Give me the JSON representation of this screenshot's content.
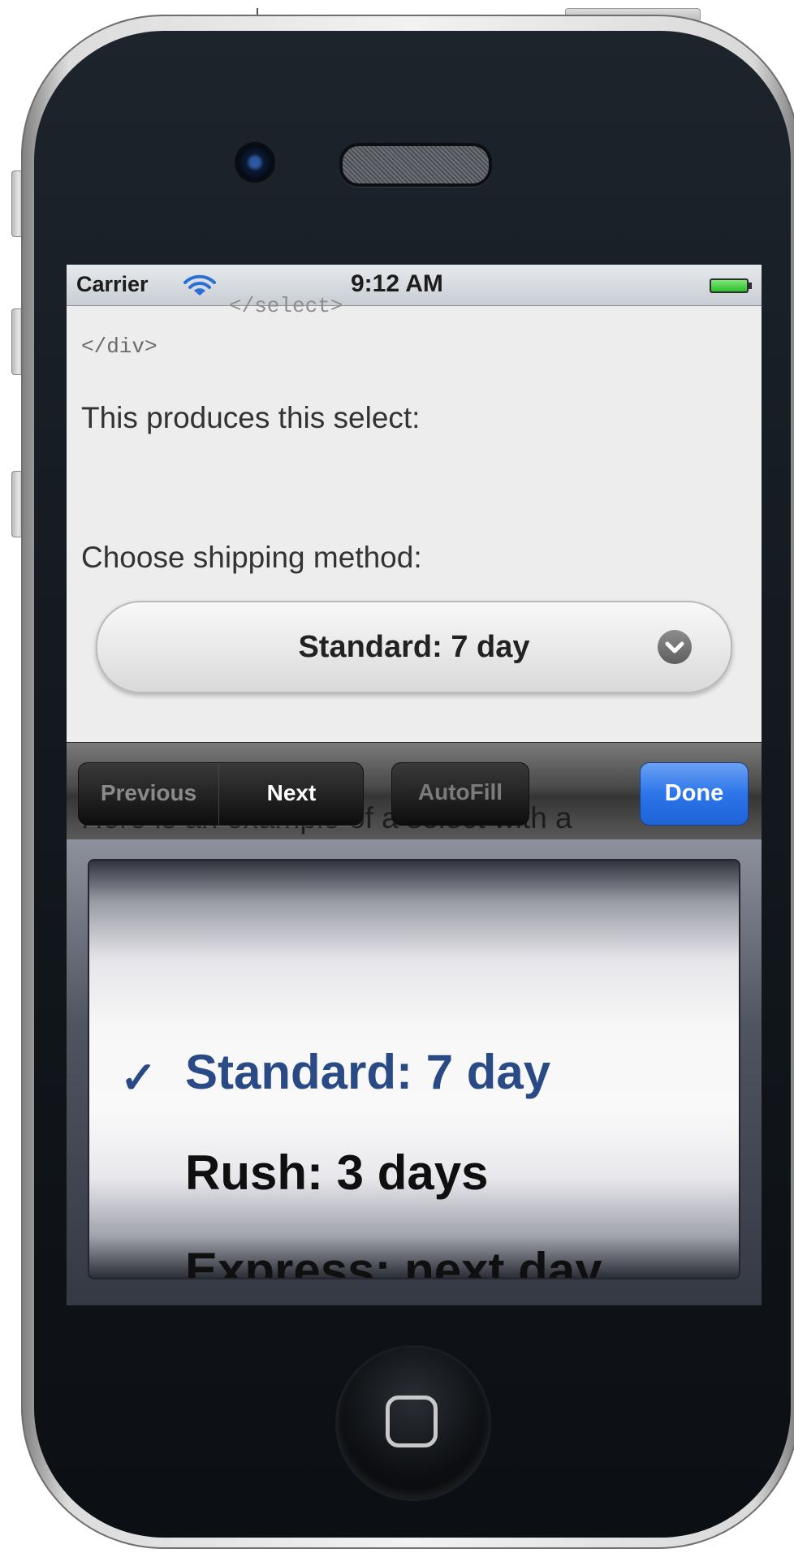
{
  "status_bar": {
    "carrier": "Carrier",
    "time": "9:12 AM",
    "wifi_icon": "wifi-icon",
    "battery_icon": "battery-icon"
  },
  "content": {
    "code_overlap": "</select>",
    "code_close_div": "</div>",
    "paragraph": "This produces this select:",
    "select_label": "Choose shipping method:",
    "select_value": "Standard: 7 day",
    "behind_text": "Here is an example of a select with a"
  },
  "toolbar": {
    "previous_label": "Previous",
    "next_label": "Next",
    "autofill_label": "AutoFill",
    "done_label": "Done"
  },
  "picker": {
    "check_glyph": "✓",
    "options": [
      {
        "label": "Standard: 7 day",
        "selected": true
      },
      {
        "label": "Rush: 3 days",
        "selected": false
      },
      {
        "label": "Express: next day",
        "selected": false
      }
    ]
  },
  "colors": {
    "done_button": "#2c75ea",
    "selected_option": "#2a4a85"
  }
}
